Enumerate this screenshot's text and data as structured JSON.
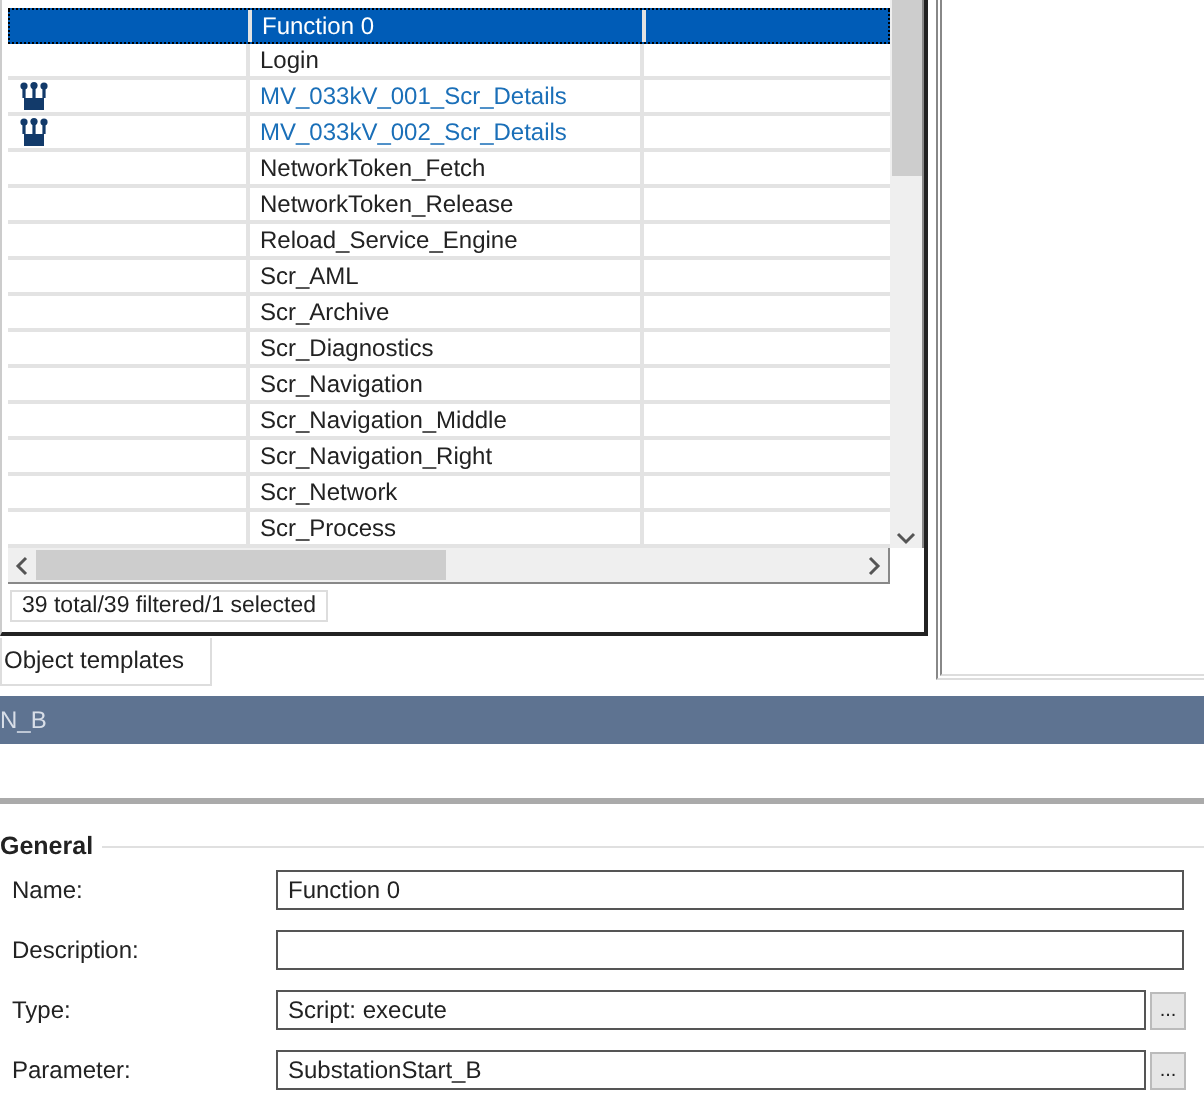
{
  "table": {
    "rows": [
      {
        "name": "Function 0",
        "kind": "plain",
        "selected": true
      },
      {
        "name": "Login",
        "kind": "plain",
        "selected": false
      },
      {
        "name": "MV_033kV_001_Scr_Details",
        "kind": "screen",
        "selected": false
      },
      {
        "name": "MV_033kV_002_Scr_Details",
        "kind": "screen",
        "selected": false
      },
      {
        "name": "NetworkToken_Fetch",
        "kind": "plain",
        "selected": false
      },
      {
        "name": "NetworkToken_Release",
        "kind": "plain",
        "selected": false
      },
      {
        "name": "Reload_Service_Engine",
        "kind": "plain",
        "selected": false
      },
      {
        "name": "Scr_AML",
        "kind": "plain",
        "selected": false
      },
      {
        "name": "Scr_Archive",
        "kind": "plain",
        "selected": false
      },
      {
        "name": "Scr_Diagnostics",
        "kind": "plain",
        "selected": false
      },
      {
        "name": "Scr_Navigation",
        "kind": "plain",
        "selected": false
      },
      {
        "name": "Scr_Navigation_Middle",
        "kind": "plain",
        "selected": false
      },
      {
        "name": "Scr_Navigation_Right",
        "kind": "plain",
        "selected": false
      },
      {
        "name": "Scr_Network",
        "kind": "plain",
        "selected": false
      },
      {
        "name": "Scr_Process",
        "kind": "plain",
        "selected": false
      }
    ],
    "status": "39 total/39 filtered/1 selected"
  },
  "tabs": [
    {
      "label": "Object templates",
      "selected": true
    }
  ],
  "header_bar": {
    "title": "N_B"
  },
  "general": {
    "title": "General",
    "fields": [
      {
        "label": "Name:",
        "value": "Function 0",
        "browse": false
      },
      {
        "label": "Description:",
        "browse": false
      },
      {
        "label": "Type:",
        "value": "Script: execute",
        "browse": true
      },
      {
        "label": "Parameter:",
        "value": "SubstationStart_B",
        "browse": true
      }
    ],
    "browse_label": "..."
  }
}
